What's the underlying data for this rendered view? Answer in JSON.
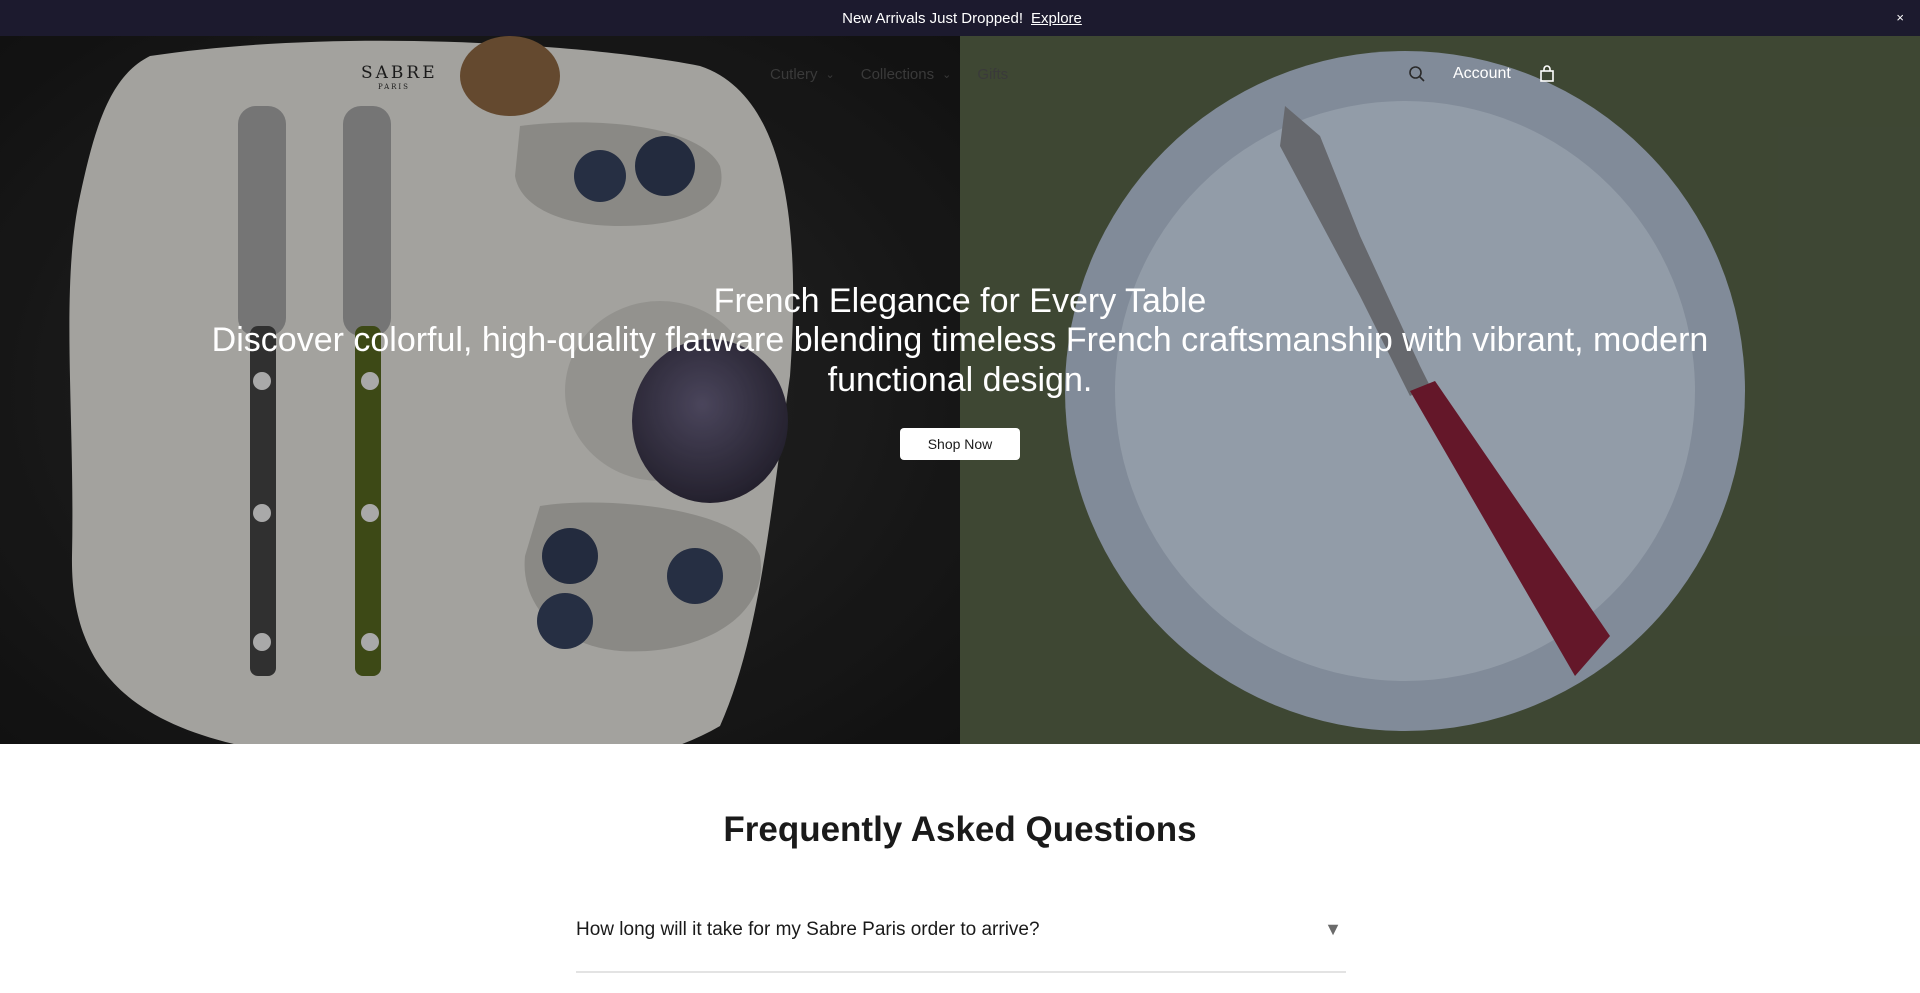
{
  "announcement": {
    "glyph": "",
    "message": "New Arrivals Just Dropped!",
    "link": "Explore",
    "close": "×"
  },
  "logo": {
    "line1": "SABRE",
    "line2": "PARIS"
  },
  "nav": {
    "items": [
      {
        "label": "Cutlery",
        "chevron": "⌄"
      },
      {
        "label": "Collections",
        "chevron": "⌄"
      },
      {
        "label": "Gifts"
      }
    ]
  },
  "header_right": {
    "search_icon": "search-icon",
    "account": "Account",
    "cart_icon": "bag-icon"
  },
  "hero": {
    "title": "French Elegance for Every Table",
    "subtitle": "Discover colorful, high-quality flatware blending timeless French craftsmanship with vibrant, modern functional design.",
    "cta": "Shop Now"
  },
  "faq": {
    "title": "Frequently Asked Questions",
    "items": [
      {
        "question": "How long will it take for my Sabre Paris order to arrive?",
        "arrow": "▼"
      }
    ]
  },
  "colors": {
    "announcement_bg": "#1c1a2e",
    "hero_left_bg": "#1b1b1b",
    "hero_right_bg": "#4a553d",
    "plate_left": "#c9c8c4",
    "plate_right": "#aab6c6",
    "knife_handle": "#7b1d33"
  }
}
